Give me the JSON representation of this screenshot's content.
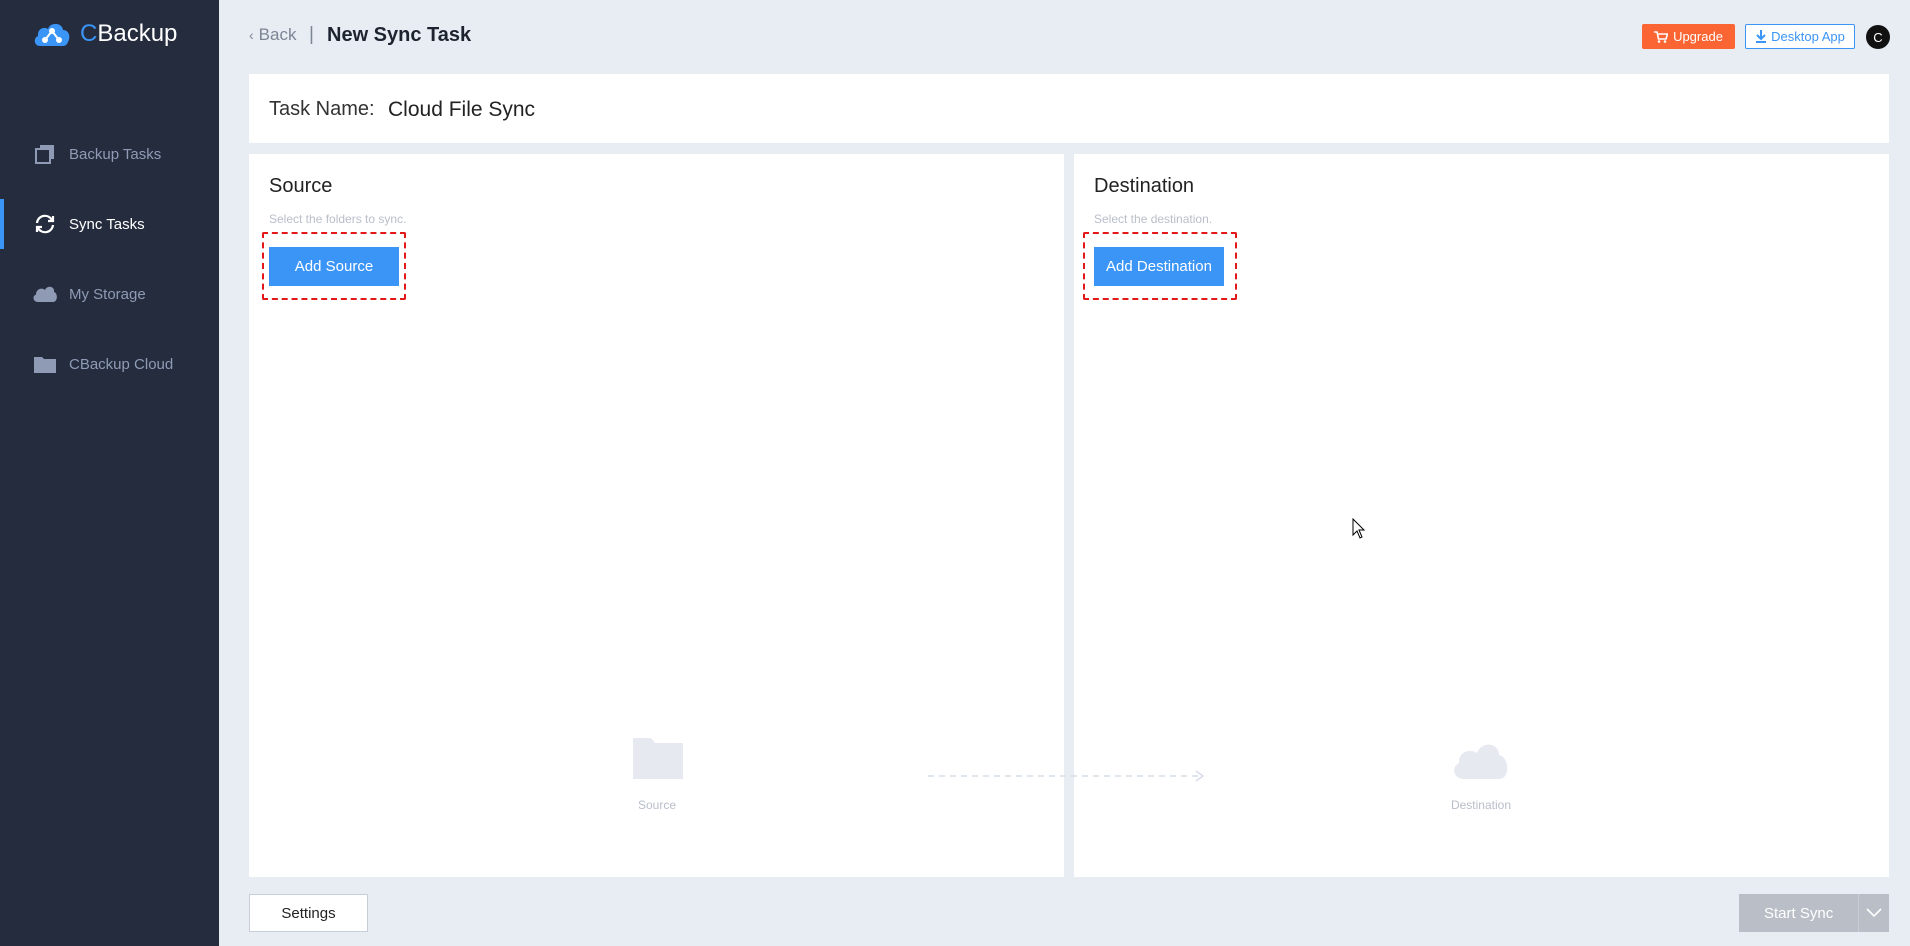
{
  "app": {
    "logo_c": "C",
    "logo_rest": "Backup"
  },
  "sidebar": {
    "items": [
      {
        "label": "Backup Tasks",
        "icon": "backup-tasks-icon",
        "active": false
      },
      {
        "label": "Sync Tasks",
        "icon": "sync-icon",
        "active": true
      },
      {
        "label": "My Storage",
        "icon": "cloud-icon",
        "active": false
      },
      {
        "label": "CBackup Cloud",
        "icon": "folder-icon",
        "active": false
      }
    ]
  },
  "header": {
    "back_label": "Back",
    "separator": "|",
    "title": "New Sync Task",
    "upgrade_label": "Upgrade",
    "desktop_app_label": "Desktop App",
    "avatar_initial": "C"
  },
  "task": {
    "label": "Task Name:",
    "value": "Cloud File Sync"
  },
  "source": {
    "title": "Source",
    "hint": "Select the folders to sync.",
    "button": "Add Source",
    "placeholder_label": "Source"
  },
  "destination": {
    "title": "Destination",
    "hint": "Select the destination.",
    "button": "Add Destination",
    "placeholder_label": "Destination"
  },
  "footer": {
    "settings_label": "Settings",
    "start_label": "Start Sync"
  },
  "colors": {
    "accent": "#3b95f6",
    "upgrade": "#fa6533",
    "sidebar_bg": "#242c3e",
    "highlight": "#e31919"
  }
}
